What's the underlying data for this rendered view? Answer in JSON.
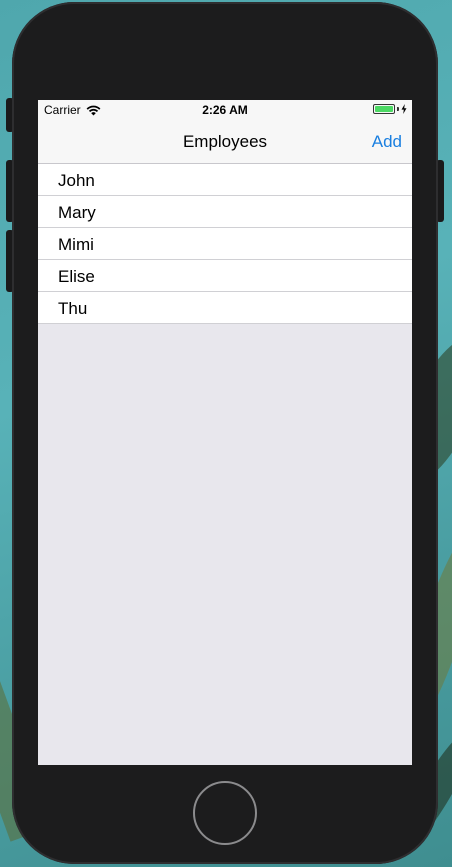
{
  "status_bar": {
    "carrier": "Carrier",
    "time": "2:26 AM",
    "battery_level": 1.0,
    "charging": true
  },
  "navigation_bar": {
    "title": "Employees",
    "add_label": "Add"
  },
  "employees": [
    {
      "name": "John"
    },
    {
      "name": "Mary"
    },
    {
      "name": "Mimi"
    },
    {
      "name": "Elise"
    },
    {
      "name": "Thu"
    }
  ],
  "colors": {
    "accent": "#1a7fe0",
    "battery": "#4cd964",
    "table_background": "#e8e7ed",
    "bar_background": "#f7f7f7"
  },
  "icons": {
    "wifi": "wifi-icon",
    "battery": "battery-icon",
    "charging": "bolt-icon",
    "home": "home-button"
  }
}
